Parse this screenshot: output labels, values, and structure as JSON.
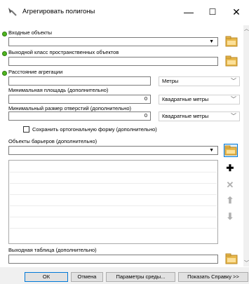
{
  "window": {
    "title": "Агрегировать полигоны",
    "minimize": "—",
    "maximize": "☐",
    "close": "✕"
  },
  "fields": {
    "input_features": {
      "label": "Входные объекты",
      "value": ""
    },
    "output_class": {
      "label": "Выходной класс пространственных объектов",
      "value": ""
    },
    "aggregation_distance": {
      "label": "Расстояние агрегации",
      "value": "",
      "unit": "Метры"
    },
    "min_area": {
      "label": "Минимальная площадь (дополнительно)",
      "value": "0",
      "unit": "Квадратные метры"
    },
    "min_hole_size": {
      "label": "Минимальный размер отверстий (дополнительно)",
      "value": "0",
      "unit": "Квадратные метры"
    },
    "orthogonal": {
      "label": "Сохранить ортогональную форму (дополнительно)",
      "checked": false
    },
    "barriers": {
      "label": "Объекты барьеров (дополнительно)",
      "value": ""
    },
    "output_table": {
      "label": "Выходная таблица (дополнительно)",
      "value": ""
    }
  },
  "buttons": {
    "ok": "ОК",
    "cancel": "Отмена",
    "env": "Параметры среды...",
    "help": "Показать Справку >>"
  },
  "colors": {
    "required_dot": "#4fb61f",
    "folder": "#e8b84a",
    "selected_border": "#0078d7"
  }
}
